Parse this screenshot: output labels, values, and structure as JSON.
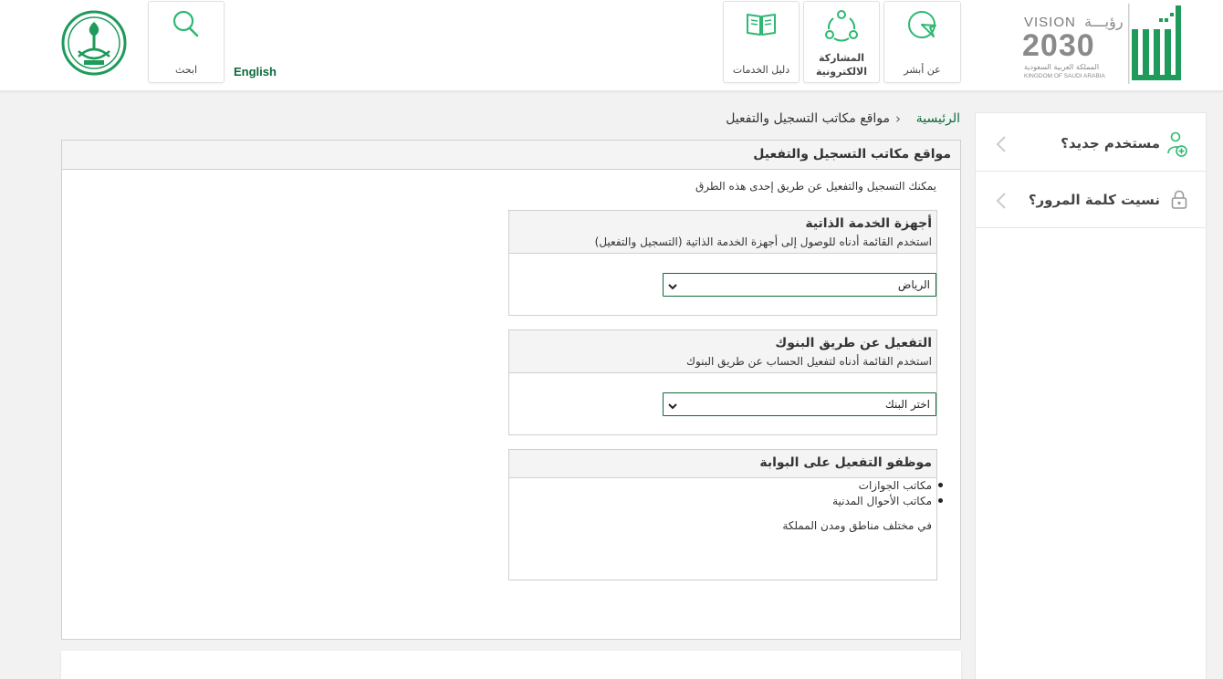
{
  "header": {
    "nav": [
      {
        "label": "عن أبشر",
        "icon": "cursor-icon"
      },
      {
        "label": "المشاركة\nالالكترونية",
        "icon": "share-network-icon"
      },
      {
        "label": "دليل الخدمات",
        "icon": "open-book-icon"
      }
    ],
    "search_label": "ابحث",
    "language_label": "English",
    "vision": {
      "word": "VISION",
      "ruya": "رؤيـــة",
      "year": "2030",
      "kingdom_ar": "المملكة العربية السعودية",
      "kingdom_en": "KINGDOM OF SAUDI ARABIA"
    }
  },
  "sidebar": {
    "items": [
      {
        "label": "مستخدم جديد؟",
        "icon": "add-user-icon"
      },
      {
        "label": "نسيت كلمة المرور؟",
        "icon": "lock-icon"
      }
    ]
  },
  "breadcrumb": {
    "home": "الرئيسية",
    "separator": "›",
    "current": "مواقع مكاتب التسجيل والتفعيل"
  },
  "main": {
    "title": "مواقع مكاتب التسجيل والتفعيل",
    "intro": "يمكنك التسجيل والتفعيل عن طريق إحدى هذه الطرق",
    "kiosks": {
      "title": "أجهزة الخدمة الذاتية",
      "subtitle": "استخدم القائمة أدناه للوصول إلى أجهزة الخدمة الذاتية (التسجيل والتفعيل)",
      "selected": "الرياض"
    },
    "banks": {
      "title": "التفعيل عن طريق البنوك",
      "subtitle": "استخدم القائمة أدناه لتفعيل الحساب عن طريق البنوك",
      "selected": "اختر البنك"
    },
    "employees": {
      "title": "موظفو التفعيل على البوابة",
      "items": [
        "مكاتب الجوازات",
        "مكاتب الأحوال المدنية"
      ],
      "note": "في مختلف مناطق ومدن المملكة"
    }
  },
  "colors": {
    "brand": "#0d6a3a",
    "accent": "#2eb872"
  }
}
